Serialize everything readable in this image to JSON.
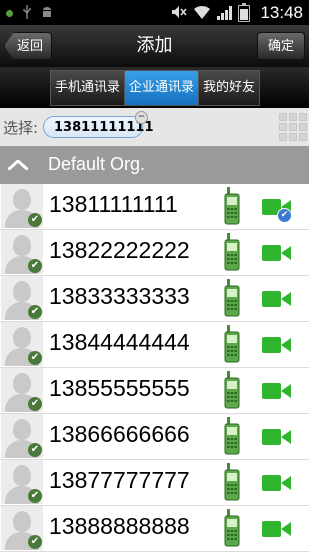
{
  "status_bar": {
    "time": "13:48",
    "battery_level": 0.85,
    "icons": [
      "notification-dot-icon",
      "usb-icon",
      "android-debug-icon",
      "mute-icon",
      "wifi-icon",
      "signal-icon",
      "battery-icon"
    ]
  },
  "header": {
    "title": "添加",
    "back_label": "返回",
    "confirm_label": "确定"
  },
  "tabs": [
    {
      "label": "手机通讯录",
      "active": false
    },
    {
      "label": "企业通讯录",
      "active": true
    },
    {
      "label": "我的好友",
      "active": false
    }
  ],
  "selection": {
    "label": "选择:",
    "chips": [
      "13811111111"
    ]
  },
  "group": {
    "name": "Default Org.",
    "expanded": true
  },
  "contacts": [
    {
      "number": "13811111111",
      "selected": true
    },
    {
      "number": "13822222222",
      "selected": false
    },
    {
      "number": "13833333333",
      "selected": false
    },
    {
      "number": "13844444444",
      "selected": false
    },
    {
      "number": "13855555555",
      "selected": false
    },
    {
      "number": "13866666666",
      "selected": false
    },
    {
      "number": "13877777777",
      "selected": false
    },
    {
      "number": "13888888888",
      "selected": false
    }
  ],
  "colors": {
    "accent_tab": "#1f86d8",
    "video_green": "#2fb52f",
    "phone_green": "#4aa84a",
    "online_check": "#4a7a3a",
    "selected_check": "#3a7ad0"
  }
}
